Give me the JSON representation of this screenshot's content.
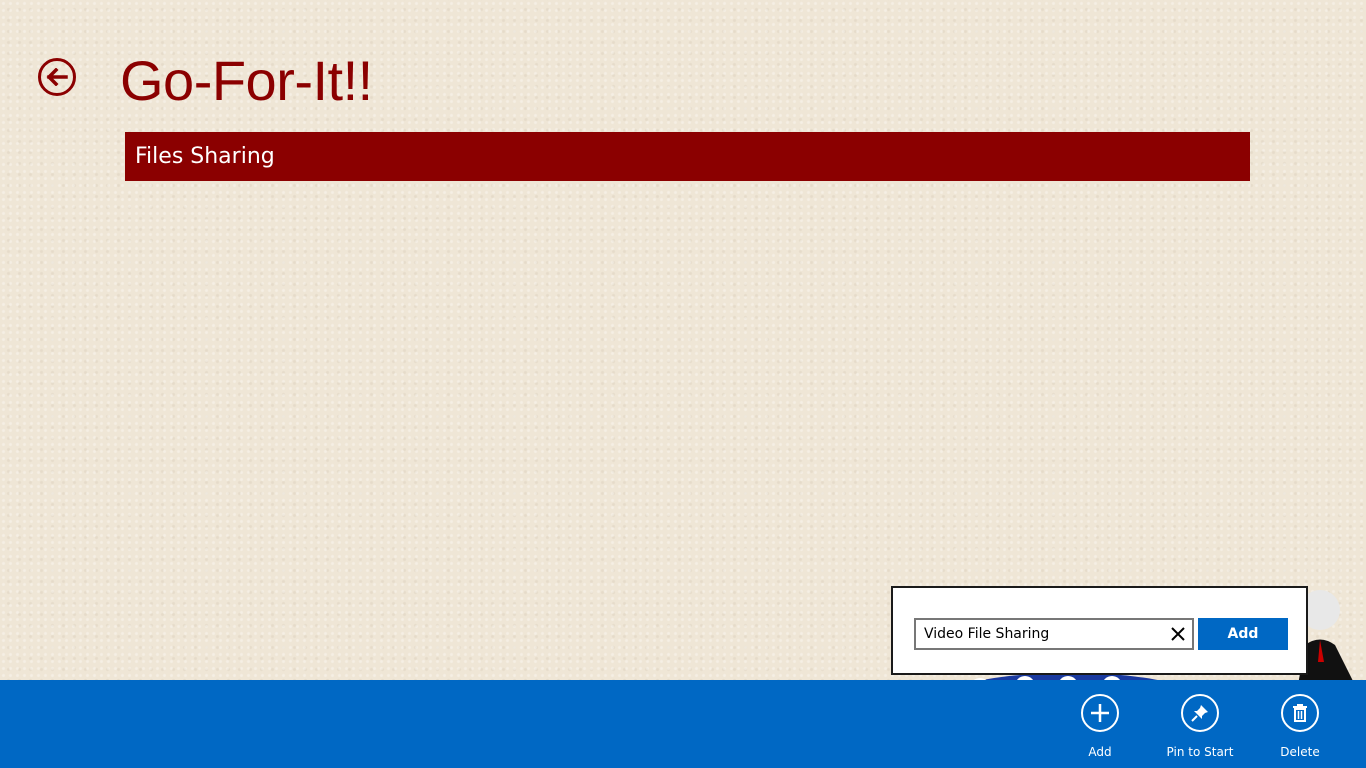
{
  "header": {
    "title": "Go-For-It!!",
    "back_icon": "back-arrow-icon"
  },
  "list": {
    "items": [
      {
        "label": "Files Sharing"
      }
    ],
    "item_color": "#8b0000"
  },
  "add_popup": {
    "input_value": "Video File Sharing",
    "clear_icon": "close-icon",
    "add_label": "Add"
  },
  "appbar": {
    "background": "#0068c4",
    "commands": [
      {
        "label": "Add",
        "icon": "plus-icon"
      },
      {
        "label": "Pin to Start",
        "icon": "pin-icon"
      },
      {
        "label": "Delete",
        "icon": "trash-icon"
      }
    ]
  }
}
